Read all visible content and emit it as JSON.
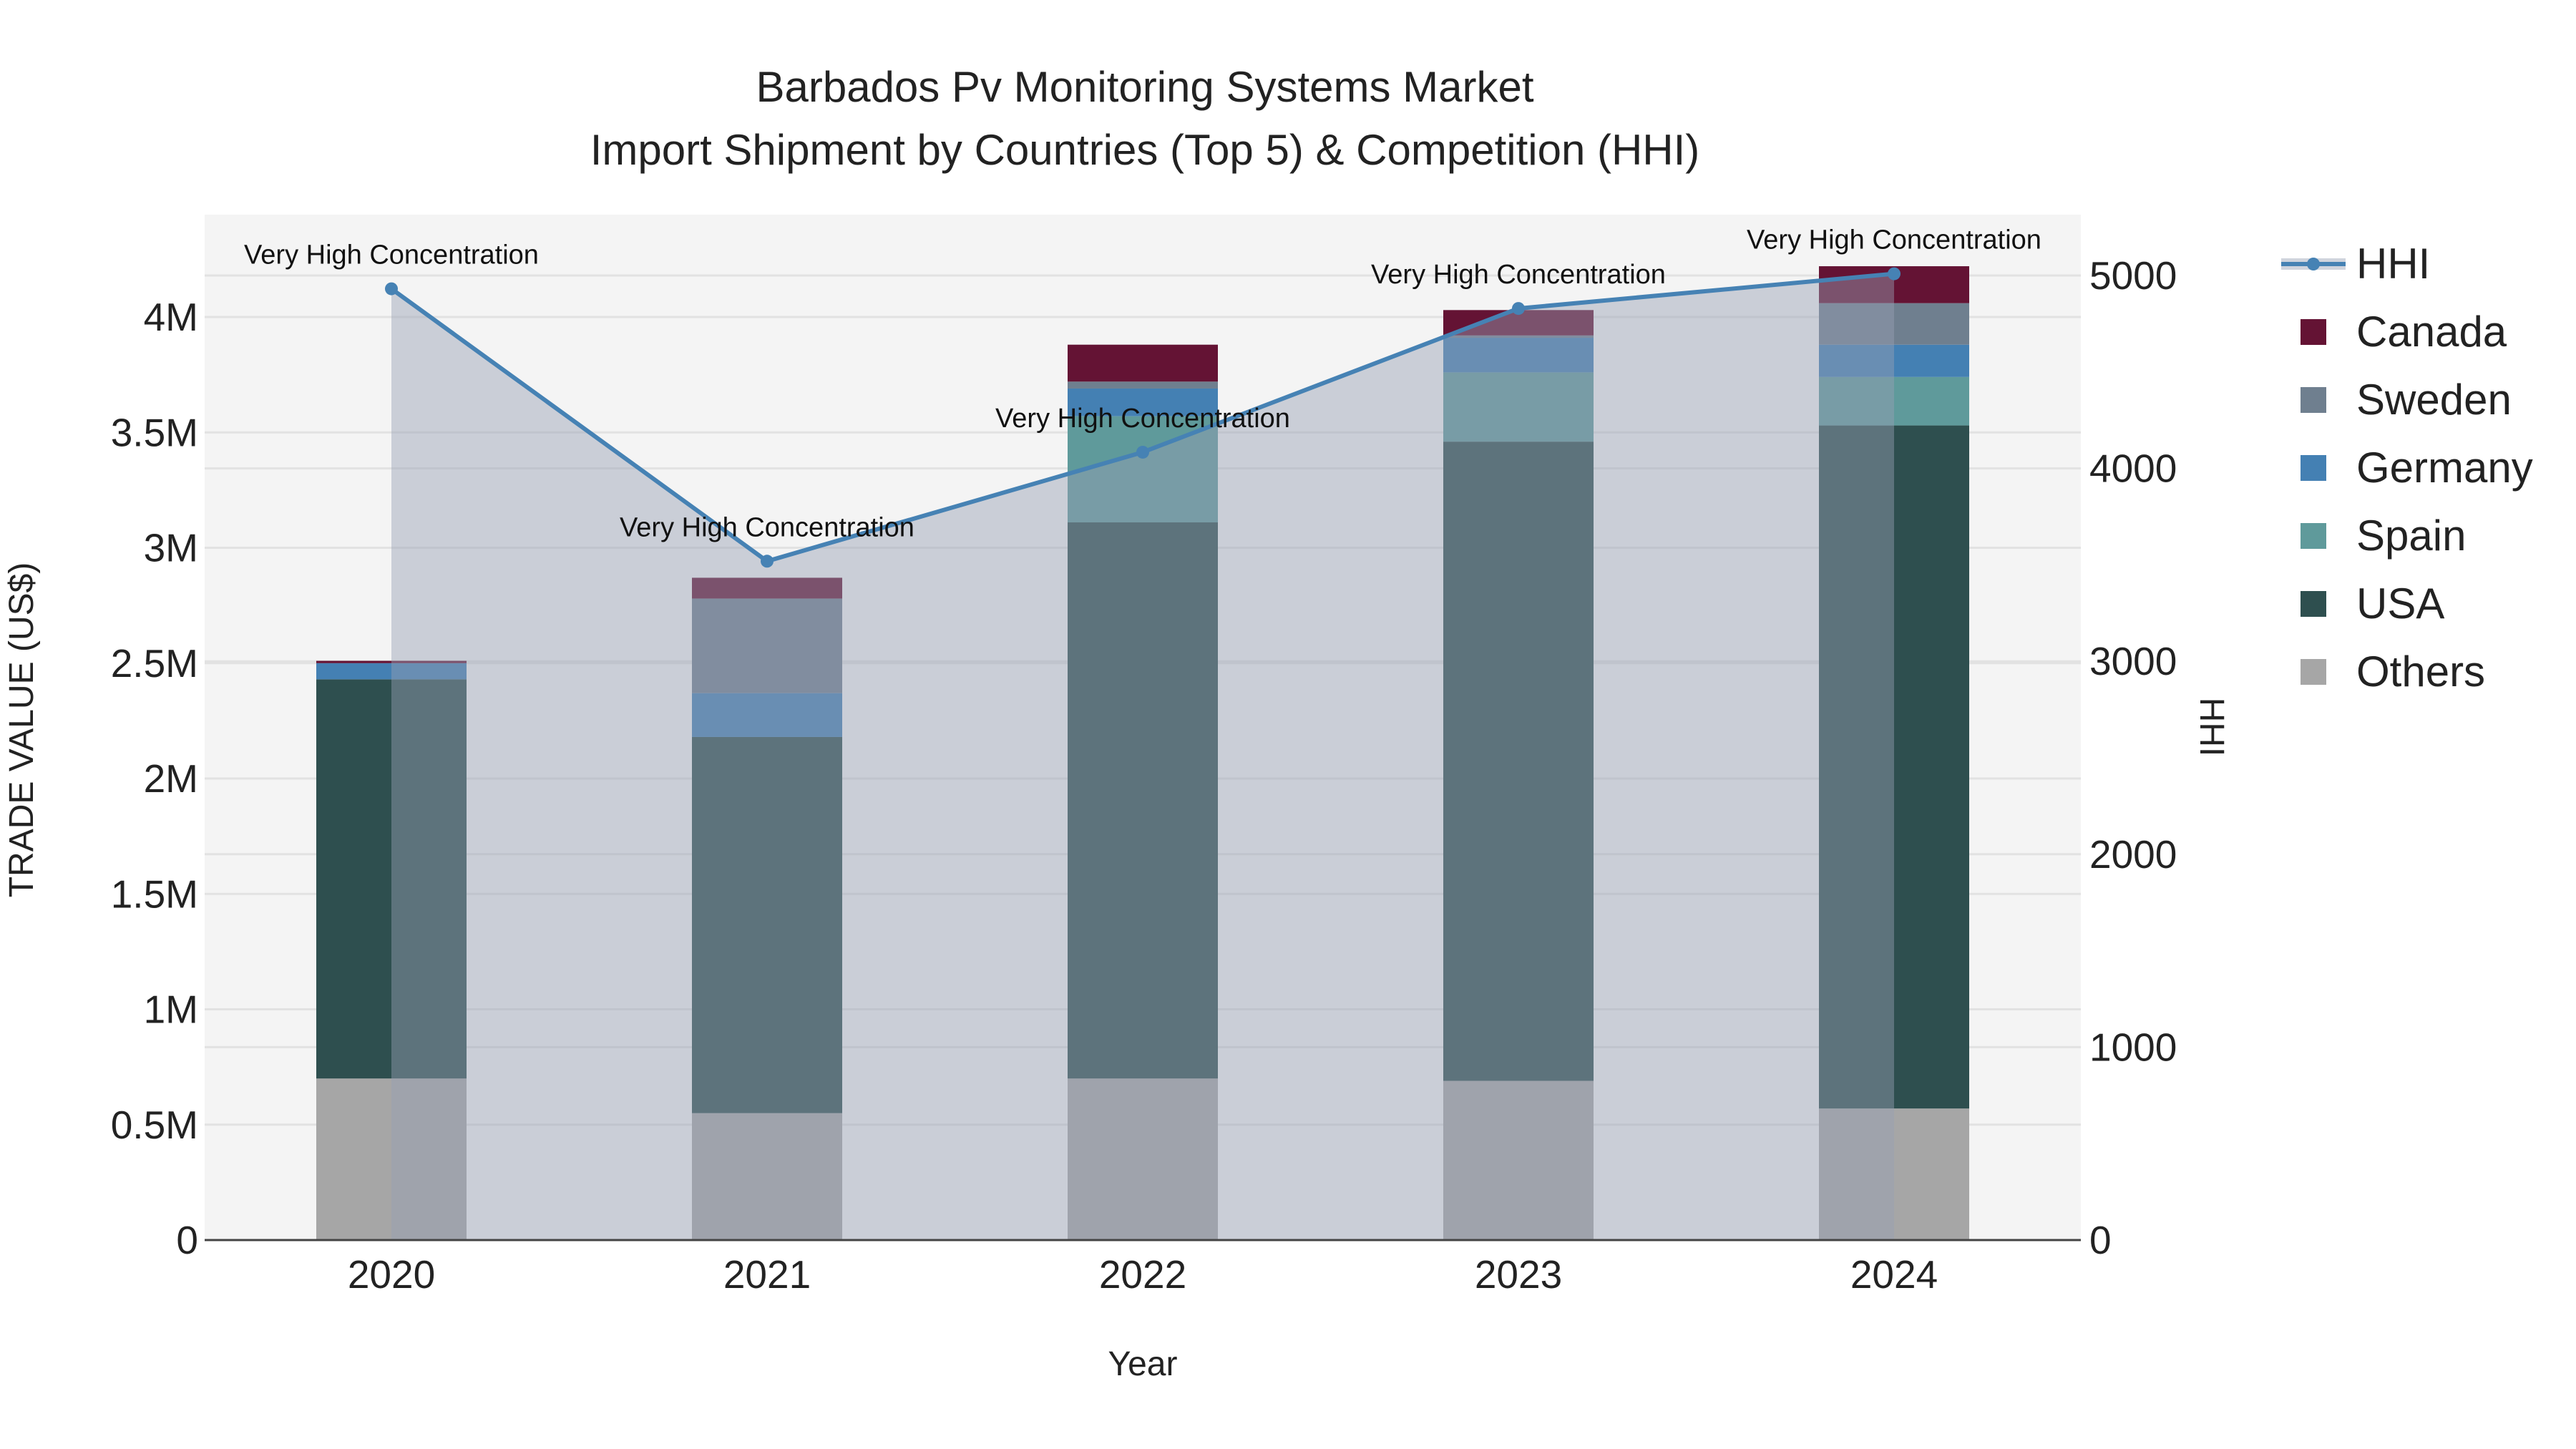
{
  "chart_data": {
    "type": "bar",
    "stacked": true,
    "title": "Barbados Pv Monitoring Systems Market",
    "subtitle": "Import Shipment by Countries (Top 5) & Competition (HHI)",
    "xlabel": "Year",
    "ylabel": "TRADE VALUE (US$)",
    "y2label": "HHI",
    "categories": [
      "2020",
      "2021",
      "2022",
      "2023",
      "2024"
    ],
    "ylim": [
      0,
      4400000
    ],
    "y2lim": [
      0,
      5300
    ],
    "yticks": [
      0,
      500000,
      1000000,
      1500000,
      2000000,
      2500000,
      3000000,
      3500000,
      4000000
    ],
    "ytick_labels": [
      "0",
      "0.5M",
      "1M",
      "1.5M",
      "2M",
      "2.5M",
      "3M",
      "3.5M",
      "4M"
    ],
    "y2ticks": [
      0,
      1000,
      2000,
      3000,
      4000,
      5000
    ],
    "y2tick_labels": [
      "0",
      "1000",
      "2000",
      "3000",
      "4000",
      "5000"
    ],
    "series": [
      {
        "name": "Others",
        "color": "#a6a6a6",
        "values": [
          700000,
          550000,
          700000,
          690000,
          570000
        ]
      },
      {
        "name": "USA",
        "color": "#2e4f4f",
        "values": [
          1730000,
          1630000,
          2410000,
          2770000,
          2960000
        ]
      },
      {
        "name": "Spain",
        "color": "#5f9a9b",
        "values": [
          0,
          0,
          460000,
          300000,
          210000
        ]
      },
      {
        "name": "Germany",
        "color": "#4480b3",
        "values": [
          70000,
          190000,
          120000,
          150000,
          140000
        ]
      },
      {
        "name": "Sweden",
        "color": "#6f7f8f",
        "values": [
          0,
          410000,
          30000,
          10000,
          180000
        ]
      },
      {
        "name": "Canada",
        "color": "#641334",
        "values": [
          10000,
          90000,
          160000,
          110000,
          160000
        ]
      }
    ],
    "line_series": {
      "name": "HHI",
      "color": "#4682b4",
      "axis": "right",
      "values": [
        4931,
        3519,
        4084,
        4829,
        5009
      ]
    },
    "annotations": [
      "Very High Concentration",
      "Very High Concentration",
      "Very High Concentration",
      "Very High Concentration",
      "Very High Concentration"
    ],
    "legend": [
      "HHI",
      "Canada",
      "Sweden",
      "Germany",
      "Spain",
      "USA",
      "Others"
    ],
    "legend_position": "right",
    "grid": true
  }
}
